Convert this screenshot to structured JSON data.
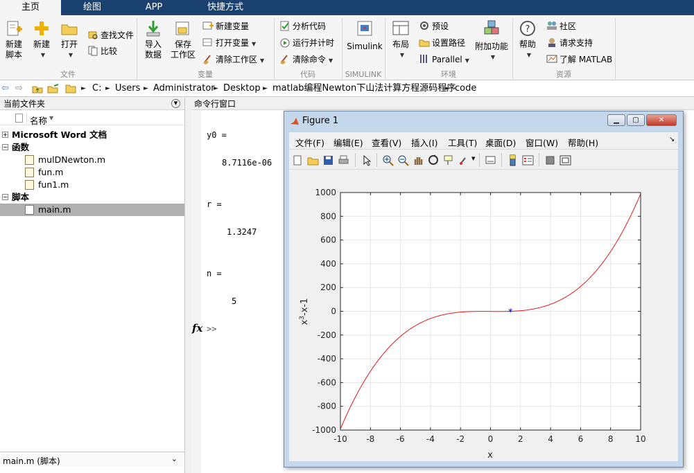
{
  "tabs": [
    {
      "label": "主页",
      "active": true
    },
    {
      "label": "绘图",
      "active": false
    },
    {
      "label": "APP",
      "active": false
    },
    {
      "label": "快捷方式",
      "active": false
    }
  ],
  "ribbon": {
    "file": {
      "section": "文件",
      "new_script": [
        "新建",
        "脚本"
      ],
      "new": "新建",
      "open": "打开",
      "find_files": "查找文件",
      "compare": "比较"
    },
    "variable": {
      "section": "变量",
      "import": [
        "导入",
        "数据"
      ],
      "save": [
        "保存",
        "工作区"
      ],
      "new_var": "新建变量",
      "open_var": "打开变量",
      "clear_ws": "清除工作区"
    },
    "code": {
      "section": "代码",
      "analyze": "分析代码",
      "run_time": "运行并计时",
      "clear_cmd": "清除命令"
    },
    "simulink": {
      "section": "SIMULINK",
      "label": "Simulink"
    },
    "env": {
      "section": "环境",
      "layout": "布局",
      "prefs": "预设",
      "set_path": "设置路径",
      "parallel": "Parallel",
      "addons": "附加功能"
    },
    "resources": {
      "section": "资源",
      "help": "帮助",
      "community": "社区",
      "support": "请求支持",
      "learn": "了解 MATLAB"
    }
  },
  "address": {
    "crumbs": [
      "C:",
      "Users",
      "Administrator",
      "Desktop",
      "matlab编程Newton下山法计算方程源码程序",
      "code"
    ]
  },
  "current_folder": {
    "title": "当前文件夹",
    "col_name": "名称",
    "groups": [
      {
        "label": "Microsoft Word 文档",
        "expanded": false,
        "files": []
      },
      {
        "label": "函数",
        "expanded": true,
        "files": [
          "mulDNewton.m",
          "fun.m",
          "fun1.m"
        ]
      },
      {
        "label": "脚本",
        "expanded": true,
        "files": [
          "main.m"
        ]
      }
    ],
    "selected": "main.m",
    "details": "main.m  (脚本)"
  },
  "command_window": {
    "title": "命令行窗口",
    "lines": [
      {
        "name": "y0 =",
        "value": "8.7116e-06"
      },
      {
        "name": "r =",
        "value": "1.3247"
      },
      {
        "name": "n =",
        "value": "5"
      }
    ],
    "prompt": ">>",
    "fx": "fx"
  },
  "figure": {
    "title": "Figure 1",
    "menus": [
      "文件(F)",
      "编辑(E)",
      "查看(V)",
      "插入(I)",
      "工具(T)",
      "桌面(D)",
      "窗口(W)",
      "帮助(H)"
    ]
  },
  "chart_data": {
    "type": "line",
    "title": "",
    "xlabel": "x",
    "ylabel": "x^3-x-1",
    "xlim": [
      -10,
      10
    ],
    "ylim": [
      -1000,
      1000
    ],
    "xticks": [
      -10,
      -8,
      -6,
      -4,
      -2,
      0,
      2,
      4,
      6,
      8,
      10
    ],
    "yticks": [
      -1000,
      -800,
      -600,
      -400,
      -200,
      0,
      200,
      400,
      600,
      800,
      1000
    ],
    "grid": true,
    "series": [
      {
        "function": "x^3-x-1",
        "color": "#e41a1c",
        "x_range": [
          -10,
          10
        ]
      },
      {
        "marker": "*",
        "color": "#0000ff",
        "points": [
          [
            1.3247,
            0
          ]
        ]
      }
    ]
  }
}
